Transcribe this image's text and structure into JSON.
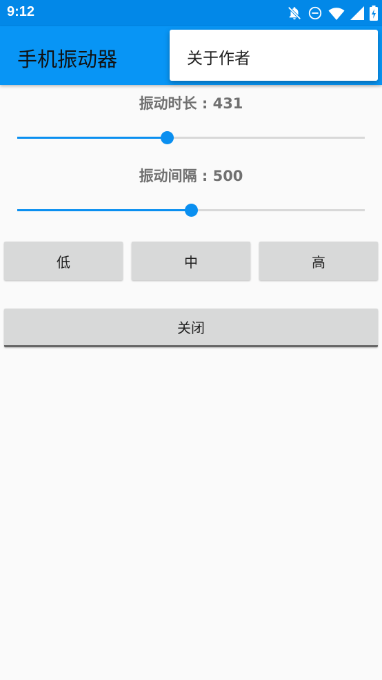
{
  "status_bar": {
    "time": "9:12",
    "icons": [
      "notifications-off-icon",
      "do-not-disturb-icon",
      "wifi-icon",
      "signal-icon",
      "battery-charging-icon"
    ]
  },
  "app_bar": {
    "title": "手机振动器"
  },
  "overflow_menu": {
    "items": [
      {
        "label": "关于作者"
      }
    ]
  },
  "duration": {
    "label": "振动时长 : 431",
    "value": 431,
    "fraction": 0.43
  },
  "interval": {
    "label": "振动间隔 : 500",
    "value": 500,
    "fraction": 0.5
  },
  "buttons": {
    "low": "低",
    "medium": "中",
    "high": "高",
    "close": "关闭"
  },
  "colors": {
    "primary": "#0895f5",
    "status_bar": "#0288e8",
    "accent": "#0a8ff0"
  }
}
